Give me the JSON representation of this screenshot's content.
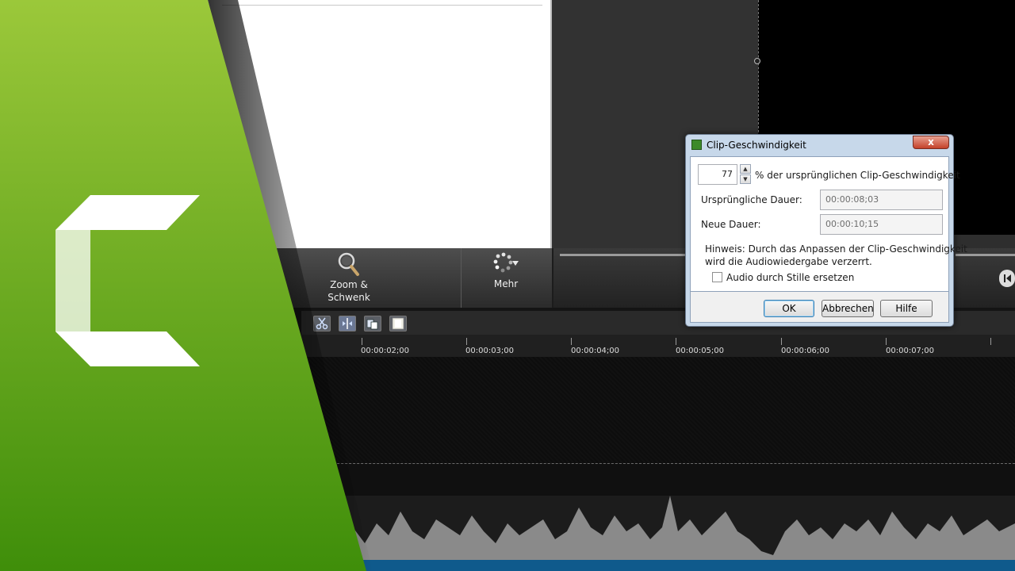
{
  "tools": {
    "zoom_label_line1": "Zoom &",
    "zoom_label_line2": "Schwenk",
    "more_label": "Mehr"
  },
  "timeline": {
    "ruler_labels": [
      "00:00:02;00",
      "00:00:03;00",
      "00:00:04;00",
      "00:00:05;00",
      "00:00:06;00",
      "00:00:07;00"
    ]
  },
  "dialog": {
    "title": "Clip-Geschwindigkeit",
    "close_symbol": "x",
    "speed_value": "77",
    "speed_suffix": "% der ursprünglichen Clip-Geschwindigkeit",
    "original_duration_label": "Ursprüngliche Dauer:",
    "original_duration_value": "00:00:08;03",
    "new_duration_label": "Neue Dauer:",
    "new_duration_value": "00:00:10;15",
    "hint_line1": "Hinweis: Durch das Anpassen der Clip-Geschwindigkeit",
    "hint_line2": "wird die Audiowiedergabe verzerrt.",
    "checkbox_label": "Audio durch Stille ersetzen",
    "checkbox_checked": false,
    "ok_label": "OK",
    "cancel_label": "Abbrechen",
    "help_label": "Hilfe"
  },
  "icons": {
    "zoom": "magnifier-icon",
    "more": "more-spinner-icon",
    "logo": "camtasia-logo"
  },
  "colors": {
    "brand_green_top": "#9bc83a",
    "brand_green_bottom": "#3f8e0a",
    "dialog_frame": "#c7d8ea",
    "audio_bar": "#0f5a8c"
  }
}
